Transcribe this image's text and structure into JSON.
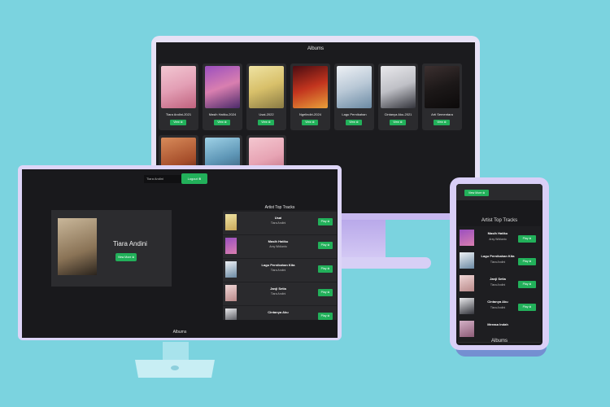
{
  "monitor": {
    "section_title": "Albums",
    "row1": [
      {
        "name": "Tiara Andini-2021",
        "button": "View ⊗",
        "grad": "linear-gradient(160deg,#f2c7d2,#e39fb5 50%,#c0627e)"
      },
      {
        "name": "Masih Hatiku-2024",
        "button": "View ⊗",
        "grad": "linear-gradient(160deg,#9b4fbf,#d97fb0 50%,#4b2a6a)"
      },
      {
        "name": "Usai-2022",
        "button": "View ⊗",
        "grad": "linear-gradient(160deg,#efe3a3,#d8c06a 50%,#8a7b44)"
      },
      {
        "name": "Ngelindiri-2024",
        "button": "View ⊗",
        "grad": "linear-gradient(160deg,#4a0c12,#c2341e 50%,#e8a03a)"
      },
      {
        "name": "Lagu Pernikahan",
        "button": "View ⊗",
        "grad": "linear-gradient(160deg,#eef1f5,#b9c8d6 50%,#6b8aa4)"
      },
      {
        "name": "Cintanya Aku-2021",
        "button": "View ⊗",
        "grad": "linear-gradient(160deg,#e9e9ec,#bfc0c6 50%,#33343b)"
      },
      {
        "name": "Arti Sementara",
        "button": "View ⊗",
        "grad": "linear-gradient(160deg,#3c3030,#1c1818 50%,#0c0a0a)"
      }
    ],
    "row2": [
      {
        "name": "",
        "grad": "linear-gradient(160deg,#d88b5a,#a54d2a 60%,#3a1c12)"
      },
      {
        "name": "",
        "grad": "linear-gradient(160deg,#9fd2e7,#5e96b6 50%,#2f4f6a)"
      },
      {
        "name": "",
        "grad": "linear-gradient(160deg,#f4c7d0,#e7a4b4 50%,#b8647a)"
      }
    ]
  },
  "laptop": {
    "search_placeholder": "Tiara Andini",
    "login_label": "Logout ⊗",
    "artist_name": "Tiara Andini",
    "view_more": "View More ⊗",
    "tracks_title": "Artist Top Tracks",
    "tracks": [
      {
        "title": "Usai",
        "artist": "Tiara Andini",
        "play": "Play ⊗",
        "grad": "linear-gradient(160deg,#efe3a3,#c9a85a)"
      },
      {
        "title": "Masih Hatiku",
        "artist": "Arsy Widianto",
        "play": "Play ⊗",
        "grad": "linear-gradient(160deg,#9b4fbf,#d97fb0)"
      },
      {
        "title": "Lagu Pernikahan Kita",
        "artist": "Tiara Andini",
        "play": "Play ⊗",
        "grad": "linear-gradient(160deg,#eef1f5,#6b8aa4)"
      },
      {
        "title": "Janji Setia",
        "artist": "Tiara Andini",
        "play": "Play ⊗",
        "grad": "linear-gradient(160deg,#f0d6d6,#b98a8a)"
      },
      {
        "title": "Cintanya Aku",
        "artist": "",
        "play": "Play ⊗",
        "grad": "linear-gradient(160deg,#e9e9ec,#33343b)"
      }
    ],
    "albums_title": "Albums"
  },
  "phone": {
    "view_more": "View More ⊗",
    "tracks_title": "Artist Top Tracks",
    "tracks": [
      {
        "title": "Masih Hatiku",
        "artist": "Arsy Widianto",
        "play": "Play ⊗",
        "grad": "linear-gradient(160deg,#9b4fbf,#d97fb0)"
      },
      {
        "title": "Lagu Pernikahan Kita",
        "artist": "Tiara Andini",
        "play": "Play ⊗",
        "grad": "linear-gradient(160deg,#eef1f5,#6b8aa4)"
      },
      {
        "title": "Janji Setia",
        "artist": "Tiara Andini",
        "play": "Play ⊗",
        "grad": "linear-gradient(160deg,#f0d6d6,#b98a8a)"
      },
      {
        "title": "Cintanya Aku",
        "artist": "Tiara Andini",
        "play": "Play ⊗",
        "grad": "linear-gradient(160deg,#e9e9ec,#33343b)"
      },
      {
        "title": "Merasa Indah",
        "artist": "",
        "play": "",
        "grad": "linear-gradient(160deg,#d3b0c6,#8d5c77)"
      }
    ],
    "albums_title": "Albums"
  }
}
